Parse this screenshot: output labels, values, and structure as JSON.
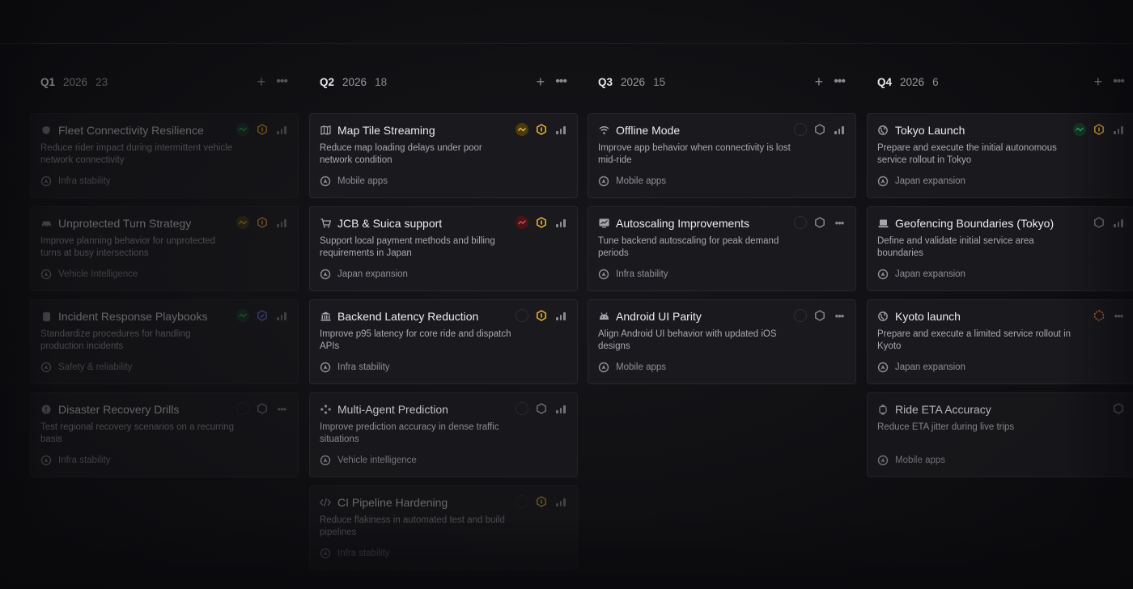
{
  "columns": [
    {
      "quarter": "Q1",
      "year": "2026",
      "count": "23",
      "cards": [
        {
          "title": "Fleet Connectivity Resilience",
          "desc": "Reduce rider impact during intermittent vehicle network connectivity",
          "project": "Infra stability"
        },
        {
          "title": "Unprotected Turn Strategy",
          "desc": "Improve planning behavior for unprotected turns at busy intersections",
          "project": "Vehicle Intelligence"
        },
        {
          "title": "Incident Response Playbooks",
          "desc": "Standardize procedures for handling production incidents",
          "project": "Safety & reliability"
        },
        {
          "title": "Disaster Recovery Drills",
          "desc": "Test regional recovery scenarios on a recurring basis",
          "project": "Infra stability"
        }
      ]
    },
    {
      "quarter": "Q2",
      "year": "2026",
      "count": "18",
      "cards": [
        {
          "title": "Map Tile Streaming",
          "desc": "Reduce map loading delays under poor network condition",
          "project": "Mobile apps"
        },
        {
          "title": "JCB & Suica support",
          "desc": "Support local payment methods and billing requirements in Japan",
          "project": "Japan expansion"
        },
        {
          "title": "Backend Latency Reduction",
          "desc": "Improve p95 latency for core ride and dispatch APIs",
          "project": "Infra stability"
        },
        {
          "title": "Multi-Agent Prediction",
          "desc": "Improve prediction accuracy in dense traffic situations",
          "project": "Vehicle intelligence"
        },
        {
          "title": "CI Pipeline Hardening",
          "desc": "Reduce flakiness in automated test and build pipelines",
          "project": "Infra stability"
        }
      ]
    },
    {
      "quarter": "Q3",
      "year": "2026",
      "count": "15",
      "cards": [
        {
          "title": "Offline Mode",
          "desc": "Improve app behavior when connectivity is lost mid-ride",
          "project": "Mobile apps"
        },
        {
          "title": "Autoscaling Improvements",
          "desc": "Tune backend autoscaling for peak demand periods",
          "project": "Infra stability"
        },
        {
          "title": "Android UI Parity",
          "desc": "Align Android UI behavior with updated iOS designs",
          "project": "Mobile apps"
        }
      ]
    },
    {
      "quarter": "Q4",
      "year": "2026",
      "count": "6",
      "cards": [
        {
          "title": "Tokyo Launch",
          "desc": "Prepare and execute the initial autonomous service rollout in Tokyo",
          "project": "Japan expansion"
        },
        {
          "title": "Geofencing Boundaries (Tokyo)",
          "desc": "Define and validate initial service area boundaries",
          "project": "Japan expansion"
        },
        {
          "title": "Kyoto launch",
          "desc": "Prepare and execute a limited service rollout in Kyoto",
          "project": "Japan expansion"
        },
        {
          "title": "Ride ETA Accuracy",
          "desc": "Reduce ETA jitter during live trips",
          "project": "Mobile apps"
        }
      ]
    }
  ],
  "colors": {
    "green": "#2fb36b",
    "yellow": "#f2b92b",
    "red": "#e5484d",
    "blue": "#6e7cf5",
    "orange": "#e8833a"
  }
}
